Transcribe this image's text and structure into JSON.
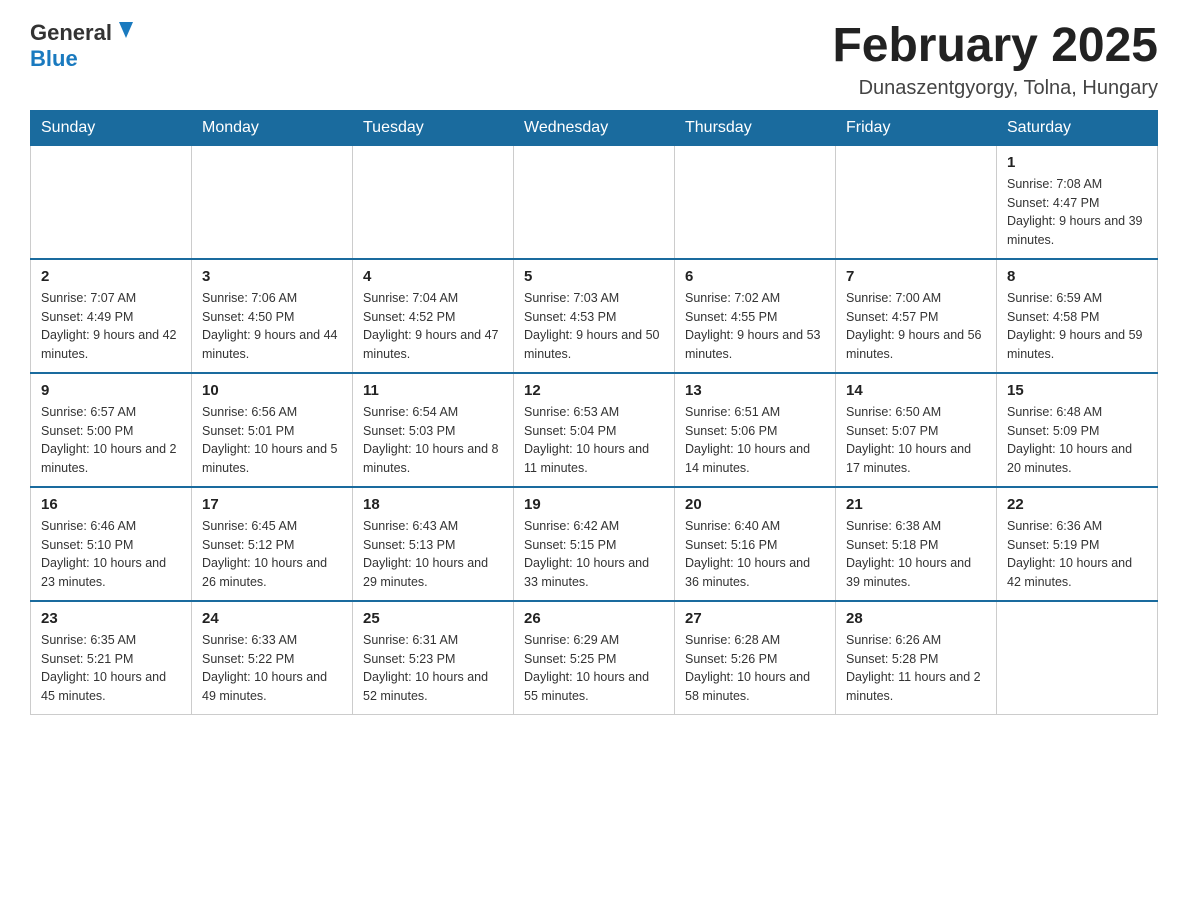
{
  "header": {
    "logo_general": "General",
    "logo_blue": "Blue",
    "month_title": "February 2025",
    "location": "Dunaszentgyorgy, Tolna, Hungary"
  },
  "days_of_week": [
    "Sunday",
    "Monday",
    "Tuesday",
    "Wednesday",
    "Thursday",
    "Friday",
    "Saturday"
  ],
  "weeks": [
    [
      {
        "day": "",
        "info": ""
      },
      {
        "day": "",
        "info": ""
      },
      {
        "day": "",
        "info": ""
      },
      {
        "day": "",
        "info": ""
      },
      {
        "day": "",
        "info": ""
      },
      {
        "day": "",
        "info": ""
      },
      {
        "day": "1",
        "info": "Sunrise: 7:08 AM\nSunset: 4:47 PM\nDaylight: 9 hours and 39 minutes."
      }
    ],
    [
      {
        "day": "2",
        "info": "Sunrise: 7:07 AM\nSunset: 4:49 PM\nDaylight: 9 hours and 42 minutes."
      },
      {
        "day": "3",
        "info": "Sunrise: 7:06 AM\nSunset: 4:50 PM\nDaylight: 9 hours and 44 minutes."
      },
      {
        "day": "4",
        "info": "Sunrise: 7:04 AM\nSunset: 4:52 PM\nDaylight: 9 hours and 47 minutes."
      },
      {
        "day": "5",
        "info": "Sunrise: 7:03 AM\nSunset: 4:53 PM\nDaylight: 9 hours and 50 minutes."
      },
      {
        "day": "6",
        "info": "Sunrise: 7:02 AM\nSunset: 4:55 PM\nDaylight: 9 hours and 53 minutes."
      },
      {
        "day": "7",
        "info": "Sunrise: 7:00 AM\nSunset: 4:57 PM\nDaylight: 9 hours and 56 minutes."
      },
      {
        "day": "8",
        "info": "Sunrise: 6:59 AM\nSunset: 4:58 PM\nDaylight: 9 hours and 59 minutes."
      }
    ],
    [
      {
        "day": "9",
        "info": "Sunrise: 6:57 AM\nSunset: 5:00 PM\nDaylight: 10 hours and 2 minutes."
      },
      {
        "day": "10",
        "info": "Sunrise: 6:56 AM\nSunset: 5:01 PM\nDaylight: 10 hours and 5 minutes."
      },
      {
        "day": "11",
        "info": "Sunrise: 6:54 AM\nSunset: 5:03 PM\nDaylight: 10 hours and 8 minutes."
      },
      {
        "day": "12",
        "info": "Sunrise: 6:53 AM\nSunset: 5:04 PM\nDaylight: 10 hours and 11 minutes."
      },
      {
        "day": "13",
        "info": "Sunrise: 6:51 AM\nSunset: 5:06 PM\nDaylight: 10 hours and 14 minutes."
      },
      {
        "day": "14",
        "info": "Sunrise: 6:50 AM\nSunset: 5:07 PM\nDaylight: 10 hours and 17 minutes."
      },
      {
        "day": "15",
        "info": "Sunrise: 6:48 AM\nSunset: 5:09 PM\nDaylight: 10 hours and 20 minutes."
      }
    ],
    [
      {
        "day": "16",
        "info": "Sunrise: 6:46 AM\nSunset: 5:10 PM\nDaylight: 10 hours and 23 minutes."
      },
      {
        "day": "17",
        "info": "Sunrise: 6:45 AM\nSunset: 5:12 PM\nDaylight: 10 hours and 26 minutes."
      },
      {
        "day": "18",
        "info": "Sunrise: 6:43 AM\nSunset: 5:13 PM\nDaylight: 10 hours and 29 minutes."
      },
      {
        "day": "19",
        "info": "Sunrise: 6:42 AM\nSunset: 5:15 PM\nDaylight: 10 hours and 33 minutes."
      },
      {
        "day": "20",
        "info": "Sunrise: 6:40 AM\nSunset: 5:16 PM\nDaylight: 10 hours and 36 minutes."
      },
      {
        "day": "21",
        "info": "Sunrise: 6:38 AM\nSunset: 5:18 PM\nDaylight: 10 hours and 39 minutes."
      },
      {
        "day": "22",
        "info": "Sunrise: 6:36 AM\nSunset: 5:19 PM\nDaylight: 10 hours and 42 minutes."
      }
    ],
    [
      {
        "day": "23",
        "info": "Sunrise: 6:35 AM\nSunset: 5:21 PM\nDaylight: 10 hours and 45 minutes."
      },
      {
        "day": "24",
        "info": "Sunrise: 6:33 AM\nSunset: 5:22 PM\nDaylight: 10 hours and 49 minutes."
      },
      {
        "day": "25",
        "info": "Sunrise: 6:31 AM\nSunset: 5:23 PM\nDaylight: 10 hours and 52 minutes."
      },
      {
        "day": "26",
        "info": "Sunrise: 6:29 AM\nSunset: 5:25 PM\nDaylight: 10 hours and 55 minutes."
      },
      {
        "day": "27",
        "info": "Sunrise: 6:28 AM\nSunset: 5:26 PM\nDaylight: 10 hours and 58 minutes."
      },
      {
        "day": "28",
        "info": "Sunrise: 6:26 AM\nSunset: 5:28 PM\nDaylight: 11 hours and 2 minutes."
      },
      {
        "day": "",
        "info": ""
      }
    ]
  ]
}
